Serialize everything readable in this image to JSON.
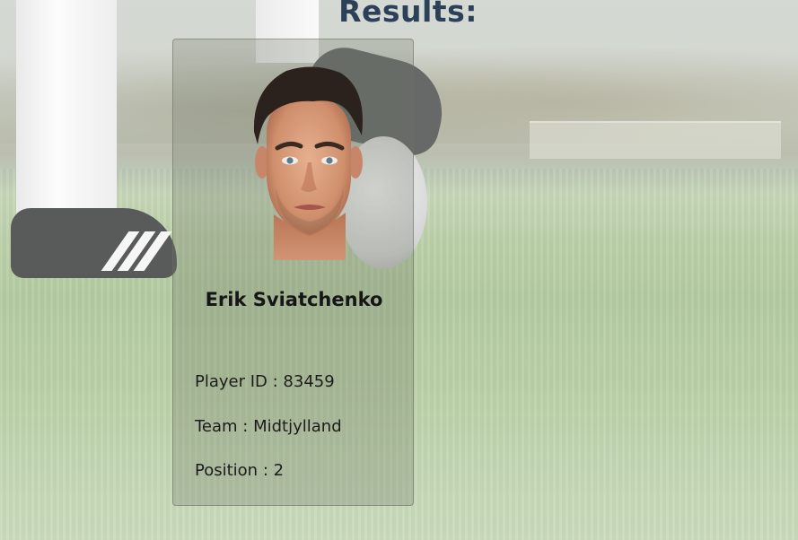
{
  "page": {
    "heading": "Results:"
  },
  "player": {
    "name": "Erik Sviatchenko",
    "photo_alt": "Erik Sviatchenko",
    "fields": [
      {
        "label": "Player ID",
        "separator": " : ",
        "value": "83459"
      },
      {
        "label": "Team",
        "separator": " : ",
        "value": "Midtjylland"
      },
      {
        "label": "Position",
        "separator": " : ",
        "value": "2"
      }
    ]
  },
  "colors": {
    "heading": "#2c4058",
    "card_text": "#1c1c1c"
  }
}
